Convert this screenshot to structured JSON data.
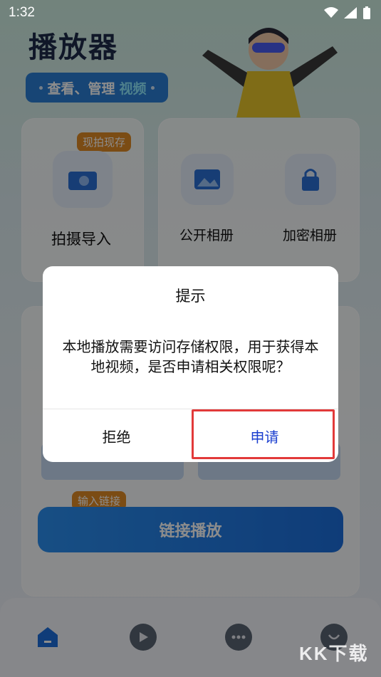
{
  "status_bar": {
    "time": "1:32"
  },
  "header": {
    "title": "播放器",
    "subtitle_prefix": "查看、管理",
    "subtitle_highlight": "视频"
  },
  "capture_card": {
    "badge": "现拍现存",
    "label": "拍摄导入"
  },
  "album_card": {
    "public_label": "公开相册",
    "private_label": "加密相册"
  },
  "link_section": {
    "badge": "输入链接",
    "button_label": "链接播放"
  },
  "dialog": {
    "title": "提示",
    "message": "本地播放需要访问存储权限，用于获得本地视频，是否申请相关权限呢？",
    "deny_label": "拒绝",
    "apply_label": "申请"
  },
  "watermark": "KK下载",
  "colors": {
    "accent": "#2a7fd6",
    "badge": "#e08a26",
    "apply_text": "#1a3ecf",
    "highlight": "#e23a3a"
  }
}
